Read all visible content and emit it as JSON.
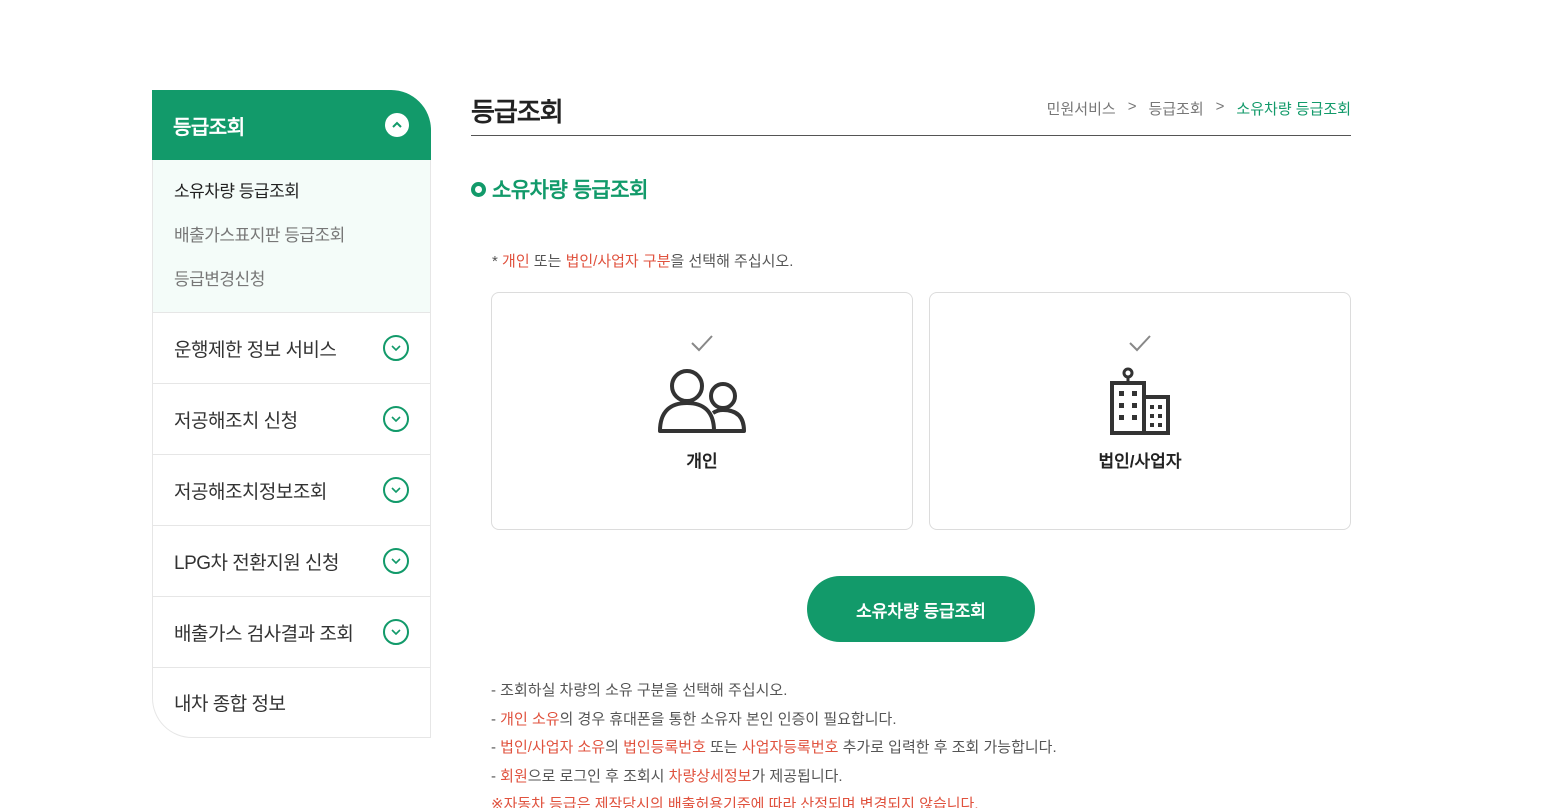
{
  "sidebar": {
    "header": "등급조회",
    "sub_items": [
      "소유차량 등급조회",
      "배출가스표지판 등급조회",
      "등급변경신청"
    ],
    "menus": [
      "운행제한 정보 서비스",
      "저공해조치 신청",
      "저공해조치정보조회",
      "LPG차 전환지원 신청",
      "배출가스 검사결과 조회",
      "내차 종합 정보"
    ]
  },
  "page": {
    "title": "등급조회",
    "breadcrumb": [
      "민원서비스",
      ">",
      "등급조회",
      ">",
      "소유차량 등급조회"
    ]
  },
  "section": {
    "title": "소유차량 등급조회"
  },
  "notice": {
    "prefix": "* ",
    "personal": "개인",
    "or": " 또는 ",
    "corp": "법인/사업자 구분",
    "suffix": "을 선택해 주십시오."
  },
  "cards": [
    {
      "label": "개인",
      "icon": "people-icon"
    },
    {
      "label": "법인/사업자",
      "icon": "building-icon"
    }
  ],
  "submit_label": "소유차량 등급조회",
  "guide": {
    "l1": "- 조회하실 차량의 소유 구분을 선택해 주십시오.",
    "l2_dash": "- ",
    "l2_red": "개인 소유",
    "l2_rest": "의 경우 휴대폰을 통한 소유자 본인 인증이 필요합니다.",
    "l3_dash": "- ",
    "l3_red1": "법인/사업자 소유",
    "l3_mid1": "의 ",
    "l3_red2": "법인등록번호",
    "l3_mid2": " 또는 ",
    "l3_red3": "사업자등록번호",
    "l3_rest": " 추가로 입력한 후 조회 가능합니다.",
    "l4_dash": "- ",
    "l4_red1": "회원",
    "l4_mid": "으로 로그인 후 조회시 ",
    "l4_red2": "차량상세정보",
    "l4_rest": "가 제공됩니다.",
    "l5": "※자동차 등급은 제작당시의 배출허용기준에 따라 산정되며 변경되지 않습니다."
  },
  "colors": {
    "accent": "#129a6a",
    "highlight": "#e0523e"
  }
}
